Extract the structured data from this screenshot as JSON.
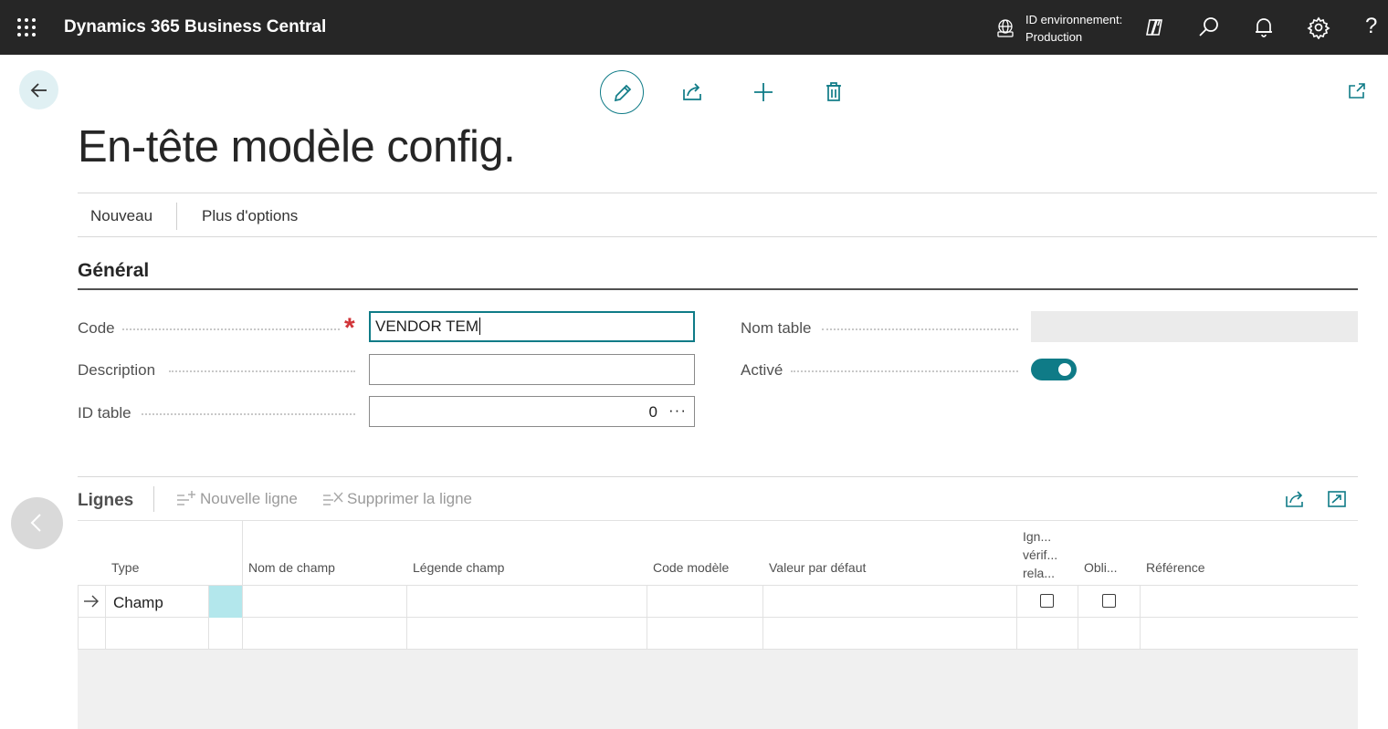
{
  "topbar": {
    "brand": "Dynamics 365 Business Central",
    "env_label": "ID environnement:",
    "env_value": "Production",
    "help": "?"
  },
  "page": {
    "title": "En-tête modèle config."
  },
  "menu": {
    "new": "Nouveau",
    "more": "Plus d'options"
  },
  "general": {
    "section_title": "Général",
    "code_label": "Code",
    "code_value": "VENDOR TEM",
    "description_label": "Description",
    "description_value": "",
    "table_id_label": "ID table",
    "table_id_value": "0",
    "table_id_lookup": "···",
    "table_name_label": "Nom table",
    "table_name_value": "",
    "active_label": "Activé",
    "active_value": true
  },
  "lines": {
    "title": "Lignes",
    "new_line": "Nouvelle ligne",
    "delete_line": "Supprimer la ligne",
    "columns": {
      "type": "Type",
      "field_name": "Nom de champ",
      "field_caption": "Légende champ",
      "template_code": "Code modèle",
      "default_value": "Valeur par défaut",
      "skip_rel_1": "Ign...",
      "skip_rel_2": "vérif...",
      "skip_rel_3": "rela...",
      "mandatory": "Obli...",
      "reference": "Référence"
    },
    "rows": [
      {
        "type": "Champ",
        "skip_relation_check": false,
        "mandatory": false
      }
    ]
  },
  "colors": {
    "accent": "#0f7b87",
    "topbar": "#262626",
    "required": "#d13438"
  }
}
